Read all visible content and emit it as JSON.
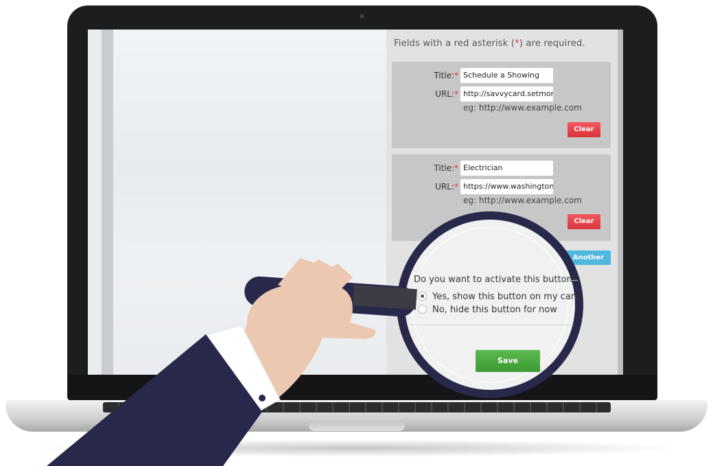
{
  "form": {
    "notice_prefix": "Fields with a red asterisk (",
    "notice_asterisk": "*",
    "notice_suffix": ") are required.",
    "links": [
      {
        "title_label": "Title:",
        "title_value": "Schedule a Showing",
        "url_label": "URL:",
        "url_value": "http://savvycard.setmore.",
        "example": "eg: http://www.example.com",
        "clear_label": "Clear"
      },
      {
        "title_label": "Title:",
        "title_value": "Electrician",
        "url_label": "URL:",
        "url_value": "https://www.washingtonp",
        "example": "eg: http://www.example.com",
        "clear_label": "Clear"
      }
    ],
    "add_another_label": "Another",
    "activation": {
      "question": "Do you want to activate this button?",
      "options": [
        {
          "label": "Yes, show this button on my card",
          "selected": true
        },
        {
          "label": "No, hide this button for now",
          "selected": false
        }
      ]
    },
    "save_label": "Save"
  },
  "colors": {
    "required": "#e0333a",
    "clear_button": "#e5434a",
    "add_button": "#4fb8de",
    "save_button": "#48a83f",
    "lens_ring": "#28284b",
    "sleeve": "#28284b"
  }
}
